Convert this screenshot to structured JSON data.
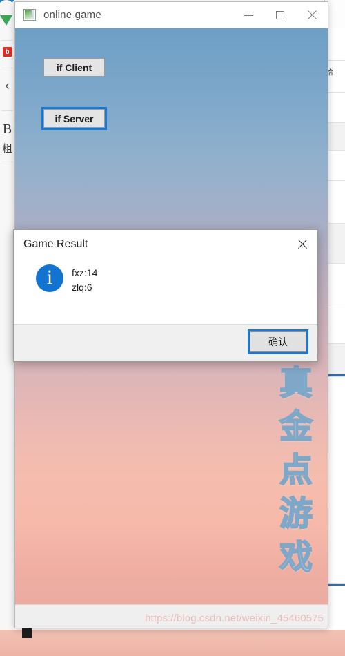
{
  "app_window": {
    "title": "online game",
    "icon": "java-app-icon",
    "controls": {
      "minimize": "minimize-icon",
      "maximize": "maximize-icon",
      "close": "close-icon"
    },
    "buttons": [
      {
        "label": "if Client",
        "focused": false
      },
      {
        "label": "if Server",
        "focused": true
      }
    ],
    "vertical_title": [
      "真",
      "金",
      "点",
      "游",
      "戏"
    ],
    "watermark": "https://blog.csdn.net/weixin_45460575"
  },
  "dialog": {
    "title": "Game Result",
    "close": "close-icon",
    "icon": "info-icon",
    "icon_glyph": "i",
    "message": "fxz:14\nzlq:6",
    "scores": [
      {
        "player": "fxz",
        "value": "14"
      },
      {
        "player": "zlq",
        "value": "6"
      }
    ],
    "ok_label": "确认"
  },
  "background": {
    "left_sidebar": [
      {
        "icon": "internet-explorer-icon",
        "label": ""
      },
      {
        "icon": "chrome-icon",
        "label": ""
      },
      {
        "icon": "red-badge-icon",
        "label": "b"
      },
      {
        "icon": "chevron-left-icon",
        "label": "‹"
      },
      {
        "icon": "bold-b-icon",
        "label": "B"
      },
      {
        "icon": "chinese-bold-icon",
        "label": "粗"
      }
    ],
    "right_panel": [
      {
        "text": ""
      },
      {
        "text": "哈"
      },
      {
        "text": ""
      },
      {
        "text": ""
      },
      {
        "text": ""
      },
      {
        "text": ""
      },
      {
        "text": ""
      },
      {
        "text": ""
      }
    ]
  },
  "colors": {
    "accent_blue": "#1b78d2",
    "info_blue": "#1273d1",
    "sky_top": "#6d9fc6",
    "sky_bottom": "#ecaba1",
    "watermark": "#e8bfb9"
  }
}
